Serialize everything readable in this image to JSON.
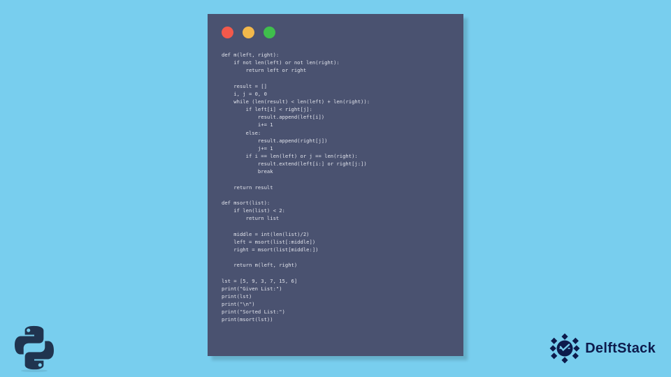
{
  "code_window": {
    "lights": [
      "red",
      "yellow",
      "green"
    ],
    "code": "def m(left, right):\n    if not len(left) or not len(right):\n        return left or right\n\n    result = []\n    i, j = 0, 0\n    while (len(result) < len(left) + len(right)):\n        if left[i] < right[j]:\n            result.append(left[i])\n            i+= 1\n        else:\n            result.append(right[j])\n            j+= 1\n        if i == len(left) or j == len(right):\n            result.extend(left[i:] or right[j:])\n            break\n\n    return result\n\ndef msort(list):\n    if len(list) < 2:\n        return list\n\n    middle = int(len(list)/2)\n    left = msort(list[:middle])\n    right = msort(list[middle:])\n\n    return m(left, right)\n\nlst = [5, 9, 3, 7, 15, 6]\nprint(\"Given List:\")\nprint(lst)\nprint(\"\\n\")\nprint(\"Sorted List:\")\nprint(msort(lst))"
  },
  "brand": {
    "name": "DelftStack"
  }
}
